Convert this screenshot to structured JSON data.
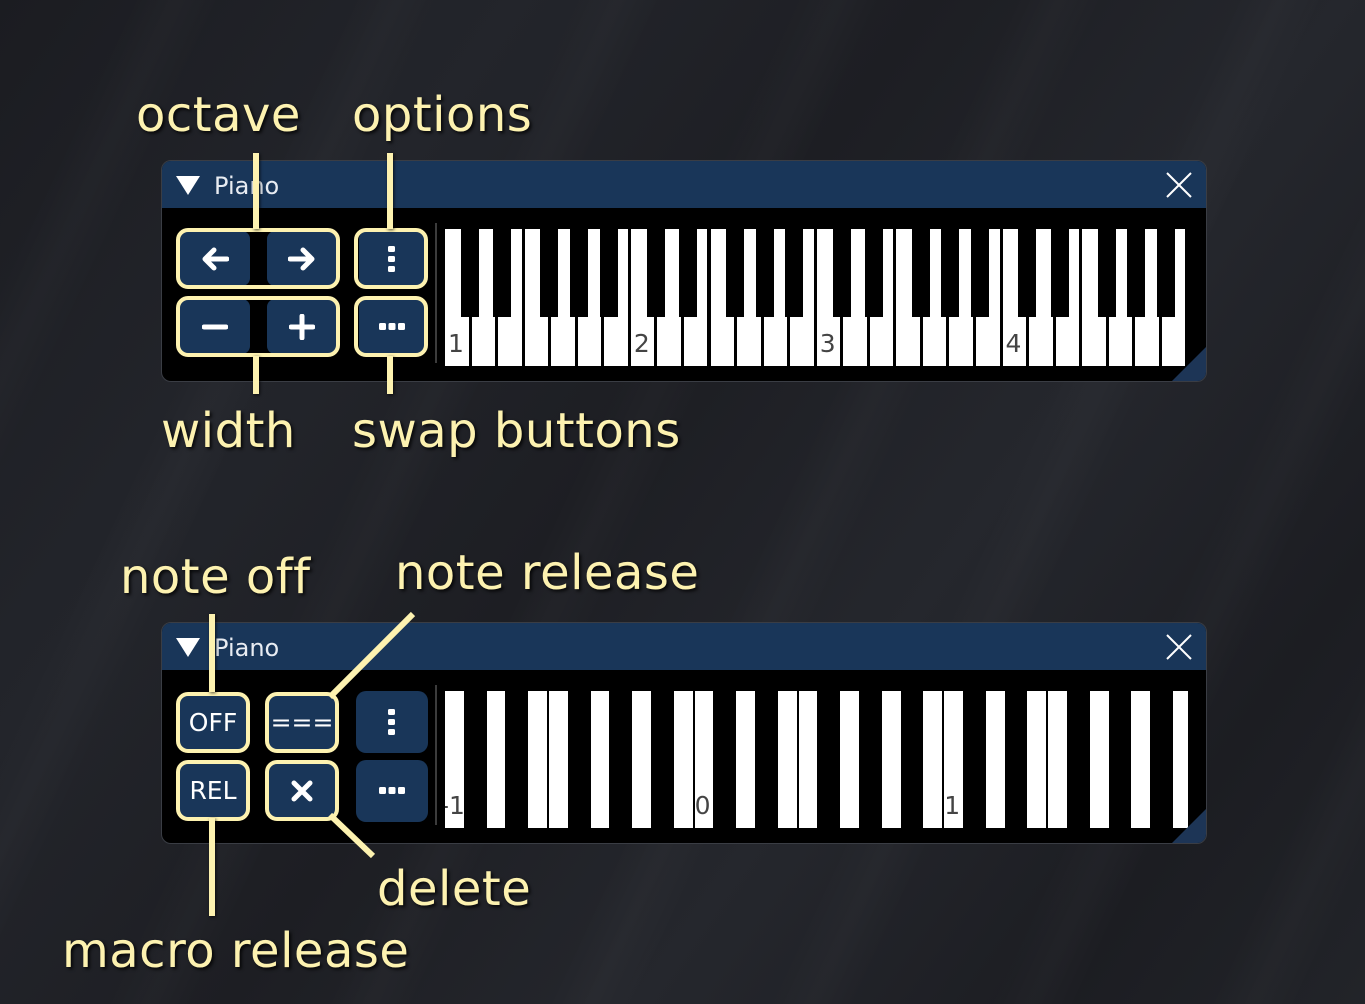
{
  "annotations": {
    "octave": "octave",
    "options": "options",
    "width": "width",
    "swap_buttons": "swap buttons",
    "note_off": "note off",
    "note_release": "note release",
    "macro_release": "macro release",
    "delete": "delete"
  },
  "colors": {
    "annotation": "#fdf2b0",
    "titlebar": "#193659",
    "button": "#193659"
  },
  "window1": {
    "title": "Piano",
    "collapse_icon": "triangle-down-icon",
    "close_icon": "close-icon",
    "buttons": {
      "octave_down": "arrow-left-icon",
      "octave_up": "arrow-right-icon",
      "width_decrease": "minus-icon",
      "width_increase": "plus-icon",
      "options": "vertical-ellipsis-icon",
      "swap": "horizontal-ellipsis-icon"
    },
    "keyboard": {
      "style": "piano",
      "octave_labels": [
        "1",
        "2",
        "3",
        "4"
      ]
    }
  },
  "window2": {
    "title": "Piano",
    "collapse_icon": "triangle-down-icon",
    "close_icon": "close-icon",
    "buttons": {
      "note_off": "OFF",
      "note_release": "===",
      "macro_release": "REL",
      "delete": "x-icon",
      "options": "vertical-ellipsis-icon",
      "swap": "horizontal-ellipsis-icon"
    },
    "keyboard": {
      "style": "bars",
      "octave_labels": [
        "-1",
        "0",
        "1"
      ]
    }
  }
}
